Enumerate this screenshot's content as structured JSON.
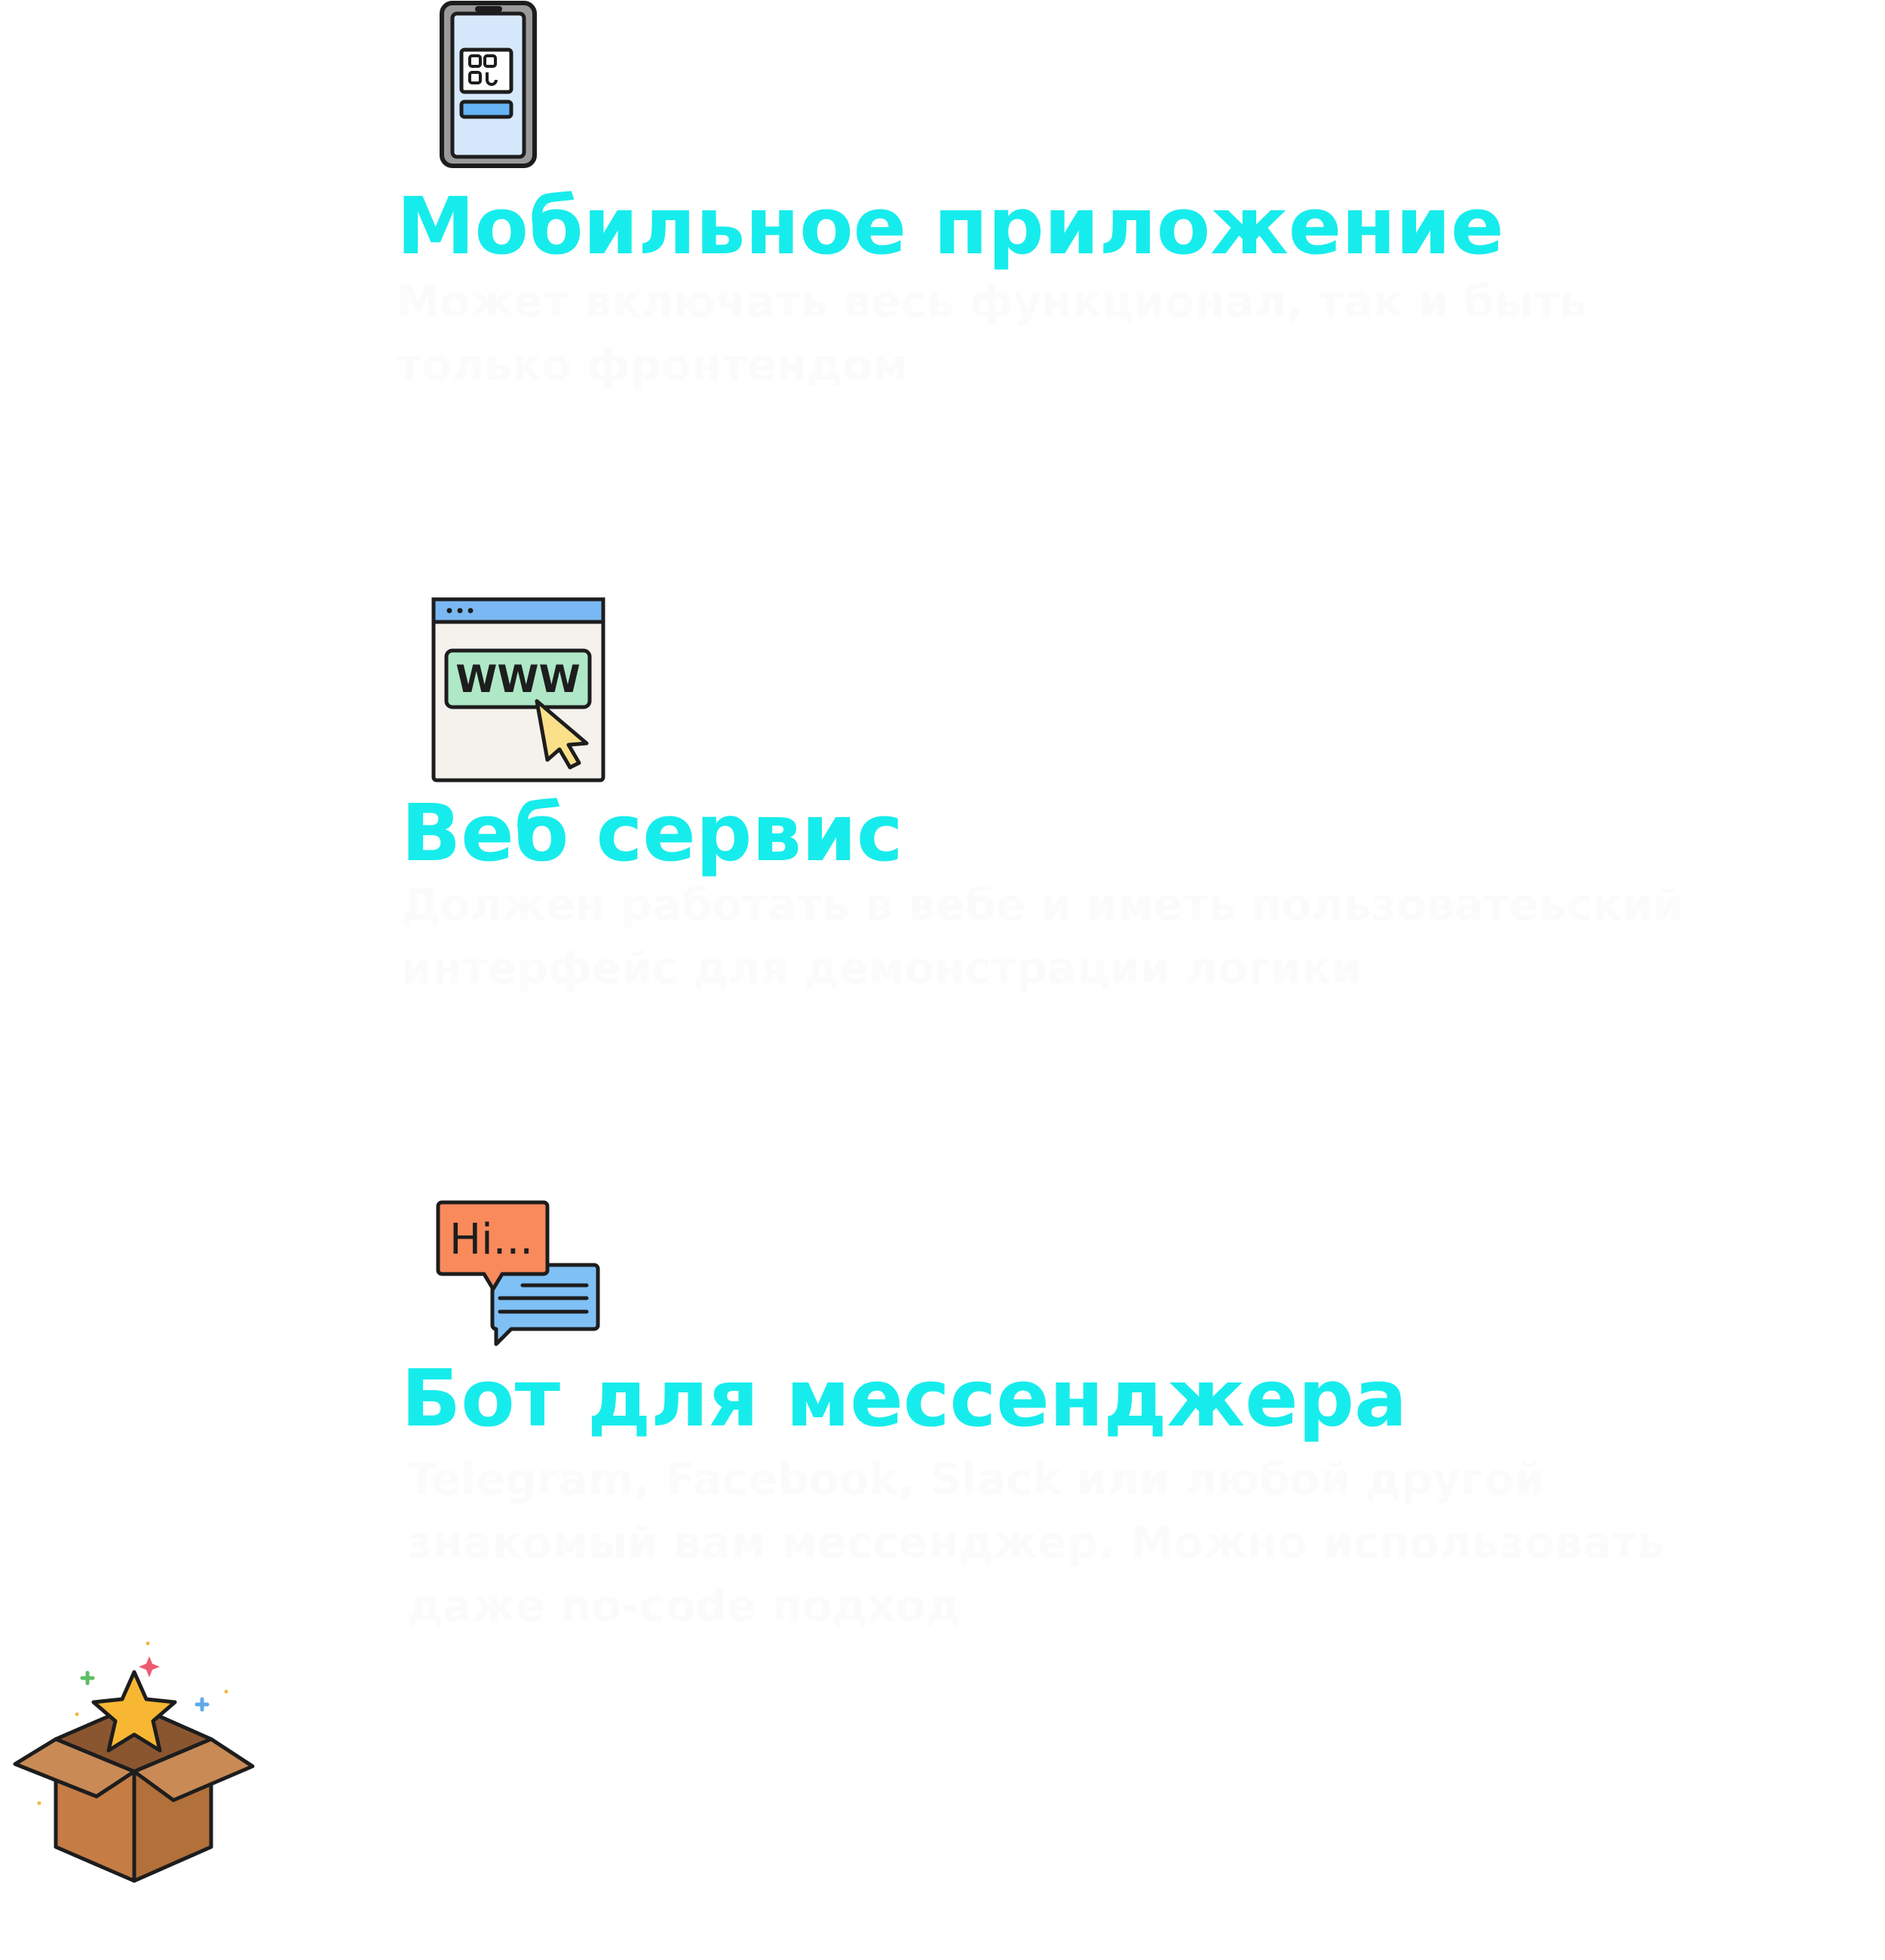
{
  "colors": {
    "title": "#17ecec",
    "description": "#fbfbfb",
    "background": "#ffffff"
  },
  "items": [
    {
      "icon": "mobile-phone-qr-icon",
      "title": "Мобильное приложение",
      "description": [
        "Может включать весь функционал, так и быть",
        "только фронтендом"
      ]
    },
    {
      "icon": "web-browser-www-icon",
      "title": "Веб сервис",
      "description": [
        "Должен работать в вебе и иметь пользоватеьский",
        "интерфейс для демонстрации логики"
      ]
    },
    {
      "icon": "chat-bubbles-icon",
      "icon_text": "Hi...",
      "title": "Бот для мессенджера",
      "description": [
        "Telegram, Facebook, Slack или любой другой",
        "знакомый вам мессенджер. Можно использовать",
        "даже no-code подход"
      ]
    }
  ],
  "extra_icon": "gift-box-star-icon"
}
